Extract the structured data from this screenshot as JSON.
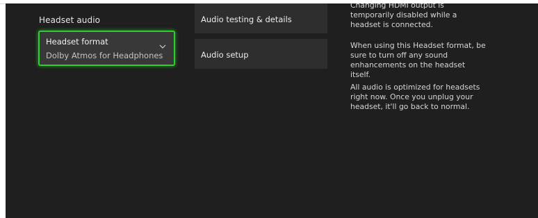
{
  "headset_audio": {
    "heading": "Headset audio",
    "format": {
      "title": "Headset format",
      "value": "Dolby Atmos for Headphones",
      "icon": "chevron-down-icon"
    }
  },
  "menu": {
    "audio_testing_label": "Audio testing & details",
    "audio_setup_label": "Audio setup"
  },
  "info_panel": {
    "paragraph_1": "Changing HDMI output is temporarily disabled while a headset is connected.",
    "paragraph_2": "When using this Headset format, be sure to turn off any sound enhancements on the headset itself.",
    "paragraph_3": "All audio is optimized for headsets right now. Once you unplug your headset, it'll go back to normal."
  },
  "colors": {
    "background": "#1f1f1f",
    "focus_accent": "#2fcf2f",
    "tile": "#2e2e2e"
  }
}
